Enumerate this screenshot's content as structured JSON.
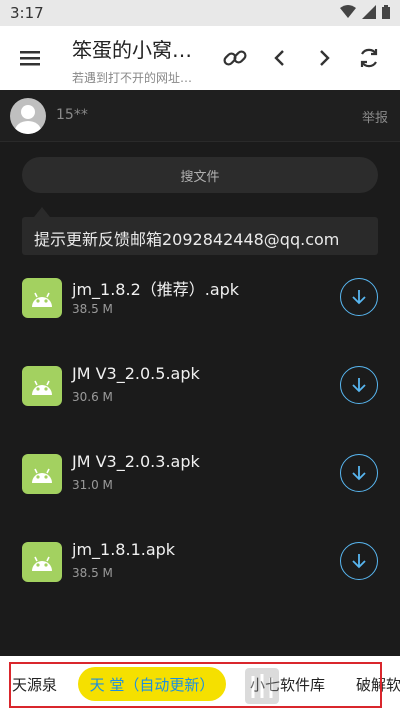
{
  "status_bar": {
    "time": "3:17"
  },
  "toolbar": {
    "title": "笨蛋的小窝…",
    "subtitle": "若遇到打不开的网址…"
  },
  "user": {
    "name": "15**",
    "report_label": "举报"
  },
  "search": {
    "label": "搜文件"
  },
  "notice": {
    "text": "提示更新反馈邮箱2092842448@qq.com"
  },
  "files": [
    {
      "name": "jm_1.8.2（推荐）.apk",
      "size": "38.5 M"
    },
    {
      "name": "JM V3_2.0.5.apk",
      "size": "30.6 M"
    },
    {
      "name": "JM V3_2.0.3.apk",
      "size": "31.0 M"
    },
    {
      "name": "jm_1.8.1.apk",
      "size": "38.5 M"
    }
  ],
  "bottom_tabs": {
    "left_partial": "天源泉",
    "active": "天 堂（自动更新）",
    "item3": "小七软件库",
    "item4": "破解软"
  },
  "colors": {
    "accent_blue": "#58b6f0",
    "active_tab_bg": "#f5e000",
    "active_tab_text": "#1d8fe0",
    "apk_icon": "#a3d160",
    "highlight_frame": "#d9262c"
  }
}
